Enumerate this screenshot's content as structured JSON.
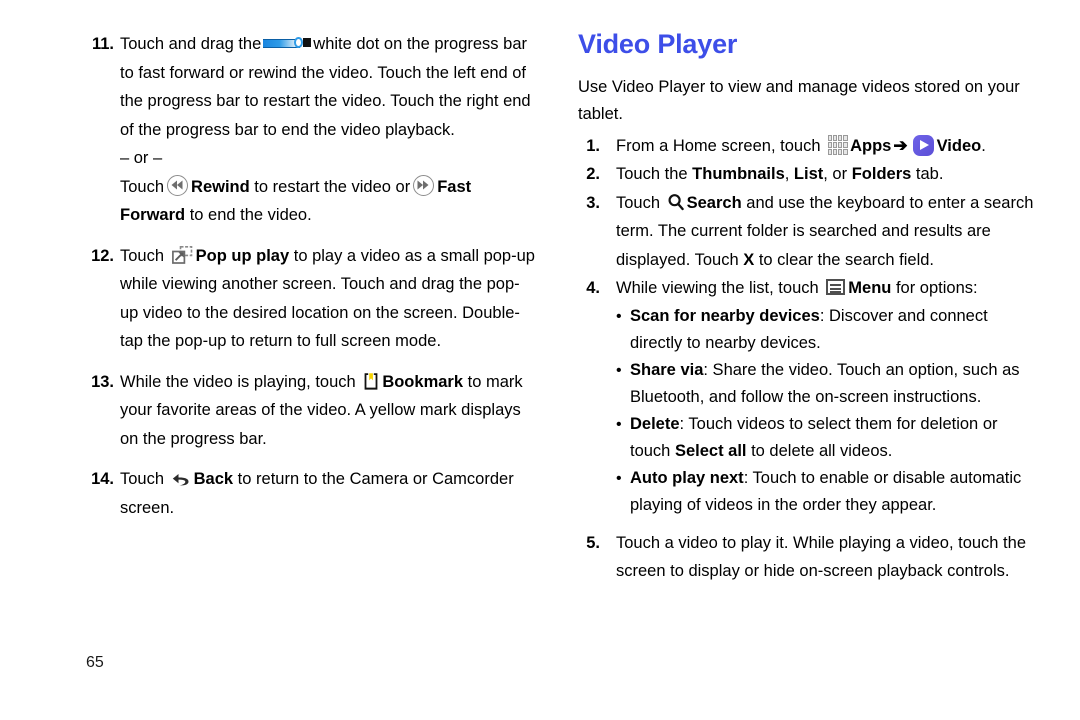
{
  "page": {
    "number": "65"
  },
  "left_column": {
    "steps": [
      {
        "num": "11.",
        "seg1": "Touch and drag the",
        "icon": "video-progress-bar-icon",
        "seg2": "white dot on the progress bar to fast forward or rewind the video. Touch the left end of the progress bar to restart the video. Touch the right end of the progress bar to end the video playback."
      }
    ],
    "or_divider": "– or –",
    "or_line": {
      "seg1": "Touch",
      "rewind_icon": "rewind-icon",
      "rewind_label": "Rewind",
      "seg2": "to restart the video or",
      "ff_icon": "fast-forward-icon",
      "ff_label": "Fast Forward",
      "seg3": "to end the video."
    },
    "step12": {
      "num": "12.",
      "seg1": "Touch",
      "icon": "pop-up-play-icon",
      "bold": "Pop up play",
      "seg2": "to play a video as a small pop-up while viewing another screen. Touch and drag the pop-up video to the desired location on the screen. Double-tap the pop-up to return to full screen mode."
    },
    "step13": {
      "num": "13.",
      "seg1": "While the video is playing, touch",
      "icon": "bookmark-icon",
      "bold": "Bookmark",
      "seg2": "to mark your favorite areas of the video. A yellow mark displays on the progress bar."
    },
    "step14": {
      "num": "14.",
      "seg1": "Touch",
      "icon": "back-icon",
      "bold": "Back",
      "seg2": "to return to the Camera or Camcorder screen."
    }
  },
  "right_column": {
    "heading": "Video Player",
    "intro": "Use Video Player to view and manage videos stored on your tablet.",
    "step1": {
      "num": "1.",
      "seg1": "From a Home screen, touch",
      "apps_icon": "apps-grid-icon",
      "apps_label": "Apps",
      "arrow": "➔",
      "video_icon": "video-app-icon",
      "video_label": "Video",
      "seg_end": "."
    },
    "step2": {
      "num": "2.",
      "seg1": "Touch the",
      "b1": "Thumbnails",
      "sep1": ", ",
      "b2": "List",
      "sep2": ", or ",
      "b3": "Folders",
      "seg2": "tab."
    },
    "step3": {
      "num": "3.",
      "seg1": "Touch",
      "icon": "search-icon",
      "bold": "Search",
      "seg2": "and use the keyboard to enter a search term. The current folder is searched and results are displayed. Touch",
      "bold2": "X",
      "seg3": "to clear the search field."
    },
    "step4": {
      "num": "4.",
      "seg1": "While viewing the list, touch",
      "icon": "menu-icon",
      "bold": "Menu",
      "seg2": "for options:",
      "bullets": [
        {
          "bullet": "•",
          "label": "Scan for nearby devices",
          "text": ": Discover and connect directly to nearby devices."
        },
        {
          "bullet": "•",
          "label": "Share via",
          "text": ": Share the video. Touch an option, such as Bluetooth, and follow the on-screen instructions."
        },
        {
          "bullet": "•",
          "label": "Delete",
          "text": ": Touch videos to select them for deletion or touch ",
          "label2": "Select all",
          "text2": " to delete all videos."
        },
        {
          "bullet": "•",
          "label": "Auto play next",
          "text": ": Touch to enable or disable automatic playing of videos in the order they appear."
        }
      ]
    },
    "step5": {
      "num": "5.",
      "text": "Touch a video to play it. While playing a video, touch the screen to display or hide on-screen playback controls."
    }
  },
  "colors": {
    "heading": "#3d4ee8",
    "video_icon": "#5b4fd6",
    "bookmark_flag": "#f5d200",
    "progress_fill": "#1a86e0"
  }
}
